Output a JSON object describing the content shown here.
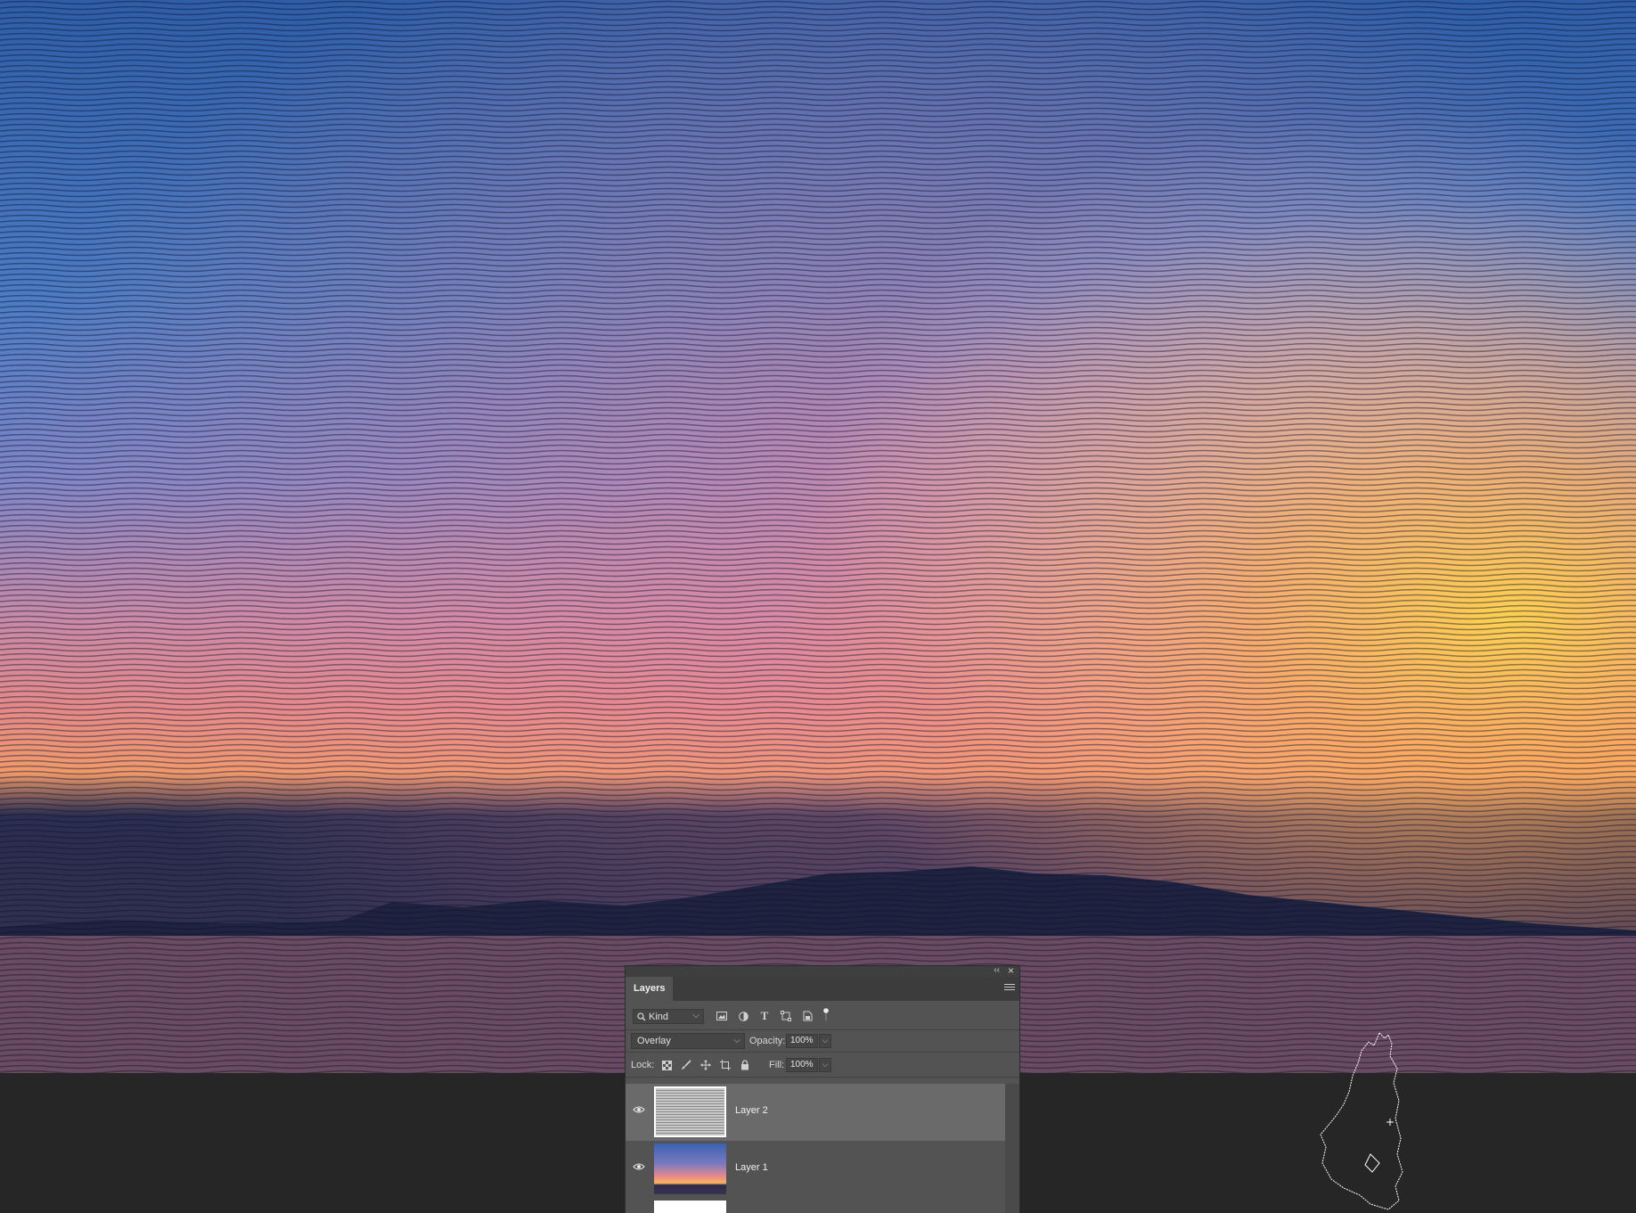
{
  "layers_panel": {
    "tab_label": "Layers",
    "filter": {
      "kind_label": "Kind"
    },
    "blend_mode": "Overlay",
    "opacity_label": "Opacity:",
    "opacity_value": "100%",
    "lock_label": "Lock:",
    "fill_label": "Fill:",
    "fill_value": "100%",
    "layers": [
      {
        "name": "Layer 2",
        "visible": true,
        "selected": true
      },
      {
        "name": "Layer 1",
        "visible": true,
        "selected": false
      },
      {
        "name": "",
        "visible": false,
        "selected": false
      }
    ]
  },
  "icons": {
    "filter_icons": [
      "image-filter-icon",
      "adjustment-filter-icon",
      "type-filter-icon",
      "shape-filter-icon",
      "smart-object-filter-icon"
    ],
    "lock_icons": [
      "lock-transparent-pixels-icon",
      "lock-image-pixels-icon",
      "lock-position-icon",
      "lock-artboard-icon",
      "lock-all-icon"
    ]
  },
  "colors": {
    "panel_bg": "#535353",
    "workspace_bg": "#262626",
    "selected_layer_bg": "#6a6a6a"
  }
}
